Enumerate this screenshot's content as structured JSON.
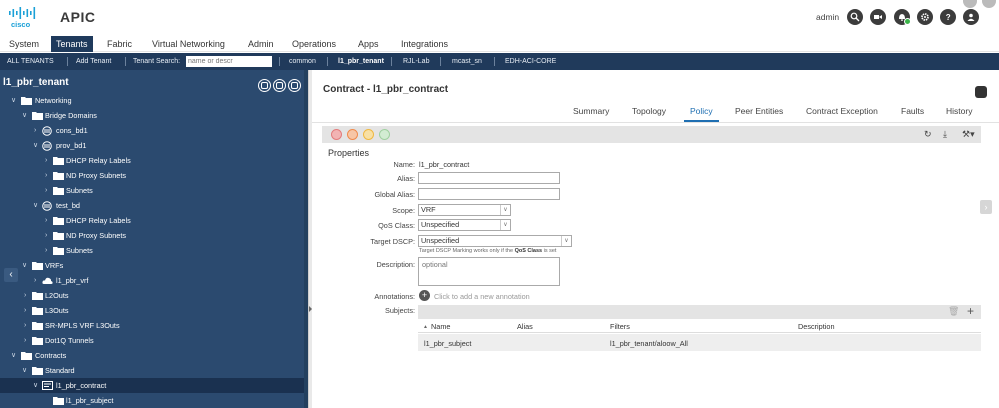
{
  "header": {
    "app_title": "APIC",
    "logo_text": "cisco",
    "user": "admin"
  },
  "menu": {
    "tabs": [
      "System",
      "Tenants",
      "Fabric",
      "Virtual Networking",
      "Admin",
      "Operations",
      "Apps",
      "Integrations"
    ],
    "active": "Tenants"
  },
  "subbar": {
    "all_tenants": "ALL TENANTS",
    "add_tenant": "Add Tenant",
    "tenant_search_label": "Tenant Search:",
    "tenant_search_placeholder": "name or descr",
    "recent": [
      "common",
      "l1_pbr_tenant",
      "RJL-Lab",
      "mcast_sn",
      "EDH-ACI-CORE"
    ]
  },
  "tree": {
    "title": "l1_pbr_tenant",
    "items": [
      {
        "label": "Networking"
      },
      {
        "label": "Bridge Domains"
      },
      {
        "label": "cons_bd1"
      },
      {
        "label": "prov_bd1"
      },
      {
        "label": "DHCP Relay Labels"
      },
      {
        "label": "ND Proxy Subnets"
      },
      {
        "label": "Subnets"
      },
      {
        "label": "test_bd"
      },
      {
        "label": "DHCP Relay Labels"
      },
      {
        "label": "ND Proxy Subnets"
      },
      {
        "label": "Subnets"
      },
      {
        "label": "VRFs"
      },
      {
        "label": "l1_pbr_vrf"
      },
      {
        "label": "L2Outs"
      },
      {
        "label": "L3Outs"
      },
      {
        "label": "SR-MPLS VRF L3Outs"
      },
      {
        "label": "Dot1Q Tunnels"
      },
      {
        "label": "Contracts"
      },
      {
        "label": "Standard"
      },
      {
        "label": "l1_pbr_contract"
      },
      {
        "label": "l1_pbr_subject"
      }
    ]
  },
  "content": {
    "title": "Contract - l1_pbr_contract",
    "tabs": [
      "Summary",
      "Topology",
      "Policy",
      "Peer Entities",
      "Contract Exception",
      "Faults",
      "History"
    ],
    "active_tab": "Policy",
    "section": "Properties",
    "fields": {
      "name_label": "Name:",
      "name_value": "l1_pbr_contract",
      "alias_label": "Alias:",
      "global_alias_label": "Global Alias:",
      "scope_label": "Scope:",
      "scope_value": "VRF",
      "qos_label": "QoS Class:",
      "qos_value": "Unspecified",
      "dscp_label": "Target DSCP:",
      "dscp_value": "Unspecified",
      "dscp_hint_pre": "Target DSCP Marking works only if the",
      "dscp_hint_bold": "QoS Class",
      "dscp_hint_post": "is set",
      "description_label": "Description:",
      "description_placeholder": "optional",
      "annotations_label": "Annotations:",
      "annotations_hint": "Click to add a new annotation",
      "subjects_label": "Subjects:"
    },
    "subjects_table": {
      "columns": [
        "Name",
        "Alias",
        "Filters",
        "Description"
      ],
      "rows": [
        {
          "name": "l1_pbr_subject",
          "alias": "",
          "filters": "l1_pbr_tenant/aloow_All",
          "description": ""
        }
      ]
    }
  },
  "colors": {
    "nav_dark": "#203a5b",
    "tree_bg": "#2b4a6f",
    "accent": "#1f6fb2"
  }
}
